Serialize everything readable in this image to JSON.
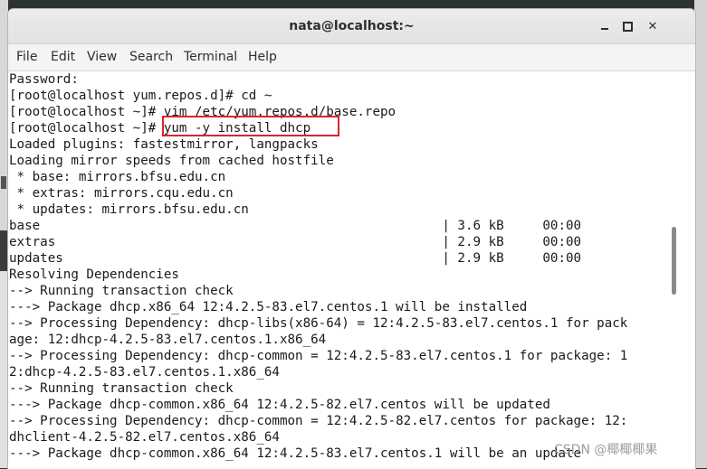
{
  "window": {
    "title": "nata@localhost:~"
  },
  "menu": {
    "file": "File",
    "edit": "Edit",
    "view": "View",
    "search": "Search",
    "terminal": "Terminal",
    "help": "Help"
  },
  "terminal": {
    "lines": [
      "Password:",
      "[root@localhost yum.repos.d]# cd ~",
      "[root@localhost ~]# vim /etc/yum.repos.d/base.repo",
      "[root@localhost ~]# yum -y install dhcp",
      "Loaded plugins: fastestmirror, langpacks",
      "Loading mirror speeds from cached hostfile",
      " * base: mirrors.bfsu.edu.cn",
      " * extras: mirrors.cqu.edu.cn",
      " * updates: mirrors.bfsu.edu.cn",
      "base                                                    | 3.6 kB     00:00",
      "extras                                                  | 2.9 kB     00:00",
      "updates                                                 | 2.9 kB     00:00",
      "Resolving Dependencies",
      "--> Running transaction check",
      "---> Package dhcp.x86_64 12:4.2.5-83.el7.centos.1 will be installed",
      "--> Processing Dependency: dhcp-libs(x86-64) = 12:4.2.5-83.el7.centos.1 for pack",
      "age: 12:dhcp-4.2.5-83.el7.centos.1.x86_64",
      "--> Processing Dependency: dhcp-common = 12:4.2.5-83.el7.centos.1 for package: 1",
      "2:dhcp-4.2.5-83.el7.centos.1.x86_64",
      "--> Running transaction check",
      "---> Package dhcp-common.x86_64 12:4.2.5-82.el7.centos will be updated",
      "--> Processing Dependency: dhcp-common = 12:4.2.5-82.el7.centos for package: 12:",
      "dhclient-4.2.5-82.el7.centos.x86_64",
      "---> Package dhcp-common.x86_64 12:4.2.5-83.el7.centos.1 will be an update"
    ]
  },
  "watermark": "CSDN @椰椰椰果",
  "colors": {
    "highlight": "#d9262c",
    "terminal_bg": "#ffffff",
    "terminal_fg": "#1a1a1a"
  }
}
